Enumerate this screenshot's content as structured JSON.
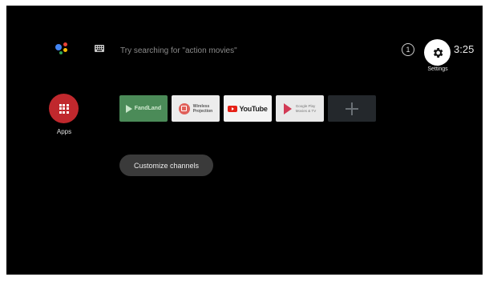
{
  "search": {
    "hint": "Try searching for \"action movies\"",
    "assistant_icon": "google-assistant-icon",
    "keyboard_icon": "keyboard-icon"
  },
  "status": {
    "notification_count": "1",
    "settings_label": "Settings",
    "clock": "3:25"
  },
  "apps": {
    "label": "Apps",
    "color": "#c0282d"
  },
  "app_row": [
    {
      "name": "FandLand",
      "bg": "#4b8b58"
    },
    {
      "name_line1": "Wireless",
      "name_line2": "Projection",
      "bg": "#ececec"
    },
    {
      "name": "YouTube",
      "bg": "#f4f4f4"
    },
    {
      "name_line1": "Google Play",
      "name_line2": "Movies & TV",
      "bg": "#e9e9e9"
    },
    {
      "icon": "plus-icon",
      "bg": "#24282c"
    }
  ],
  "customize": {
    "label": "Customize channels"
  }
}
